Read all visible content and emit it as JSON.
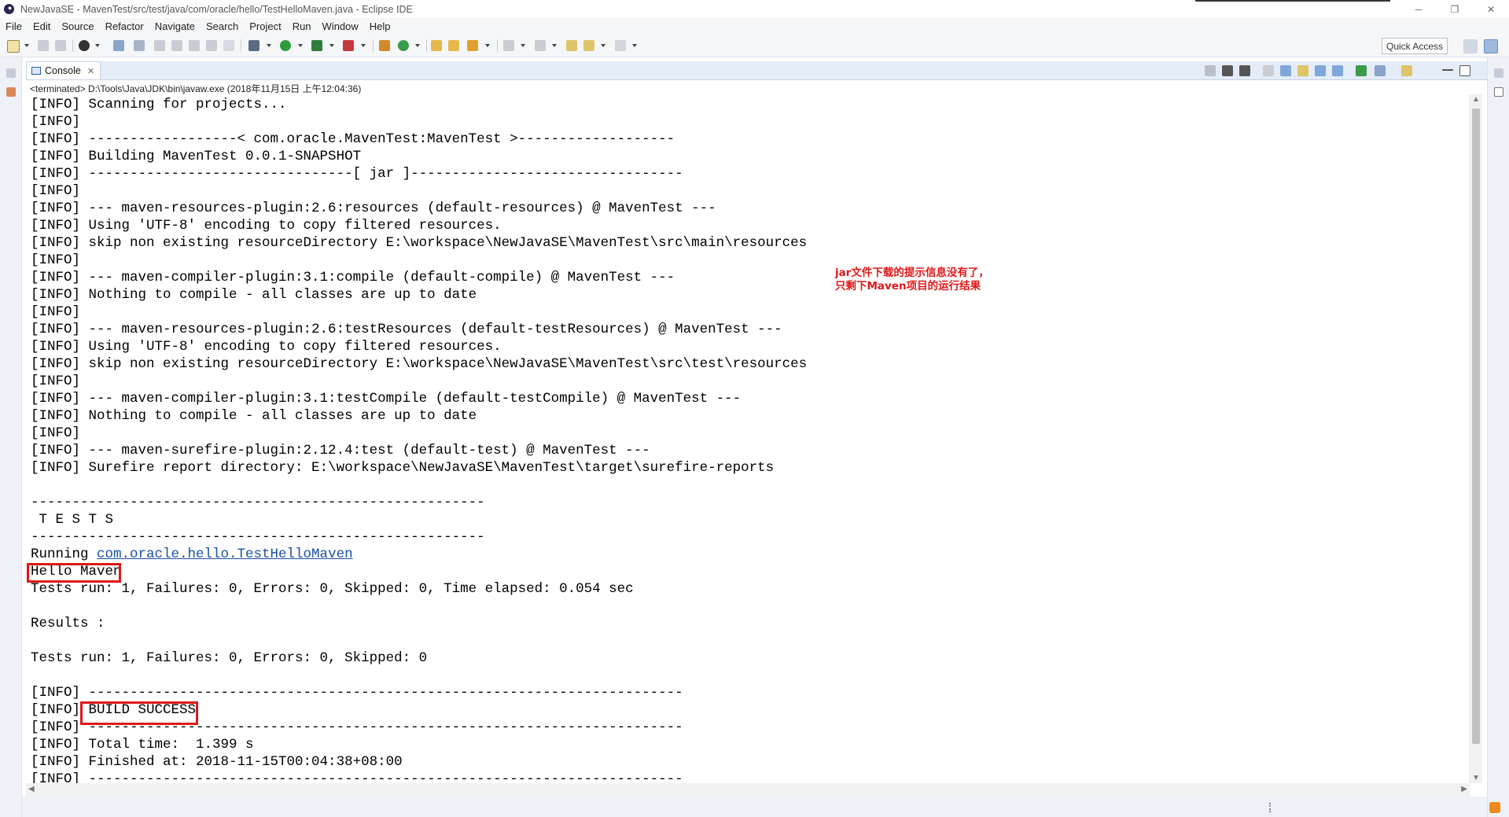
{
  "window": {
    "title": "NewJavaSE - MavenTest/src/test/java/com/oracle/hello/TestHelloMaven.java - Eclipse IDE",
    "controls": [
      "─",
      "❐",
      "✕"
    ]
  },
  "menu": [
    "File",
    "Edit",
    "Source",
    "Refactor",
    "Navigate",
    "Search",
    "Project",
    "Run",
    "Window",
    "Help"
  ],
  "toolbar": {
    "quick_access": "Quick Access"
  },
  "console": {
    "tab_label": "Console",
    "tab_close": "✕",
    "status": "<terminated> D:\\Tools\\Java\\JDK\\bin\\javaw.exe (2018年11月15日 上午12:04:36)",
    "lines": [
      "[INFO] Scanning for projects...",
      "[INFO]",
      "[INFO] ------------------< com.oracle.MavenTest:MavenTest >-------------------",
      "[INFO] Building MavenTest 0.0.1-SNAPSHOT",
      "[INFO] --------------------------------[ jar ]---------------------------------",
      "[INFO]",
      "[INFO] --- maven-resources-plugin:2.6:resources (default-resources) @ MavenTest ---",
      "[INFO] Using 'UTF-8' encoding to copy filtered resources.",
      "[INFO] skip non existing resourceDirectory E:\\workspace\\NewJavaSE\\MavenTest\\src\\main\\resources",
      "[INFO]",
      "[INFO] --- maven-compiler-plugin:3.1:compile (default-compile) @ MavenTest ---",
      "[INFO] Nothing to compile - all classes are up to date",
      "[INFO]",
      "[INFO] --- maven-resources-plugin:2.6:testResources (default-testResources) @ MavenTest ---",
      "[INFO] Using 'UTF-8' encoding to copy filtered resources.",
      "[INFO] skip non existing resourceDirectory E:\\workspace\\NewJavaSE\\MavenTest\\src\\test\\resources",
      "[INFO]",
      "[INFO] --- maven-compiler-plugin:3.1:testCompile (default-testCompile) @ MavenTest ---",
      "[INFO] Nothing to compile - all classes are up to date",
      "[INFO]",
      "[INFO] --- maven-surefire-plugin:2.12.4:test (default-test) @ MavenTest ---",
      "[INFO] Surefire report directory: E:\\workspace\\NewJavaSE\\MavenTest\\target\\surefire-reports",
      "",
      "-------------------------------------------------------",
      " T E S T S",
      "-------------------------------------------------------",
      "Running ",
      "Hello Maven",
      "Tests run: 1, Failures: 0, Errors: 0, Skipped: 0, Time elapsed: 0.054 sec",
      "",
      "Results :",
      "",
      "Tests run: 1, Failures: 0, Errors: 0, Skipped: 0",
      "",
      "[INFO] ------------------------------------------------------------------------",
      "[INFO] BUILD SUCCESS",
      "[INFO] ------------------------------------------------------------------------",
      "[INFO] Total time:  1.399 s",
      "[INFO] Finished at: 2018-11-15T00:04:38+08:00",
      "[INFO] ------------------------------------------------------------------------"
    ],
    "running_link": "com.oracle.hello.TestHelloMaven"
  },
  "annotation": {
    "line1": "jar文件下载的提示信息没有了，",
    "line2": "只剩下Maven项目的运行结果",
    "color": "#e01818"
  },
  "colors": {
    "highlight": "#e01818",
    "link": "#1a4fa8"
  }
}
